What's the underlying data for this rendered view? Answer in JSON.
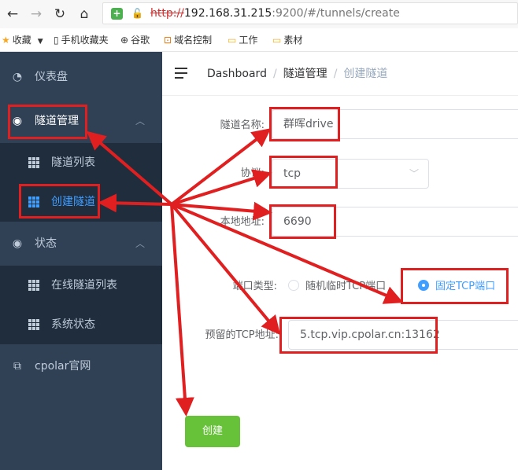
{
  "browser": {
    "url_protocol": "http://",
    "url_host": "192.168.31.215",
    "url_rest": ":9200/#/tunnels/create",
    "bookmarks": [
      {
        "icon": "★",
        "label": "收藏"
      },
      {
        "icon": "▯",
        "label": "手机收藏夹"
      },
      {
        "icon": "⊕",
        "label": "谷歌"
      },
      {
        "icon": "⊡",
        "label": "域名控制"
      },
      {
        "icon": "▭",
        "label": "工作"
      },
      {
        "icon": "▭",
        "label": "素材"
      }
    ]
  },
  "sidebar": {
    "dashboard": "仪表盘",
    "tunnel_mgmt": "隧道管理",
    "tunnel_list": "隧道列表",
    "create_tunnel": "创建隧道",
    "status": "状态",
    "online_tunnels": "在线隧道列表",
    "system_status": "系统状态",
    "cpolar_site": "cpolar官网"
  },
  "breadcrumb": {
    "home": "Dashboard",
    "section": "隧道管理",
    "current": "创建隧道"
  },
  "form": {
    "name_label": "隧道名称:",
    "name_value": "群晖drive",
    "protocol_label": "协议:",
    "protocol_value": "tcp",
    "local_addr_label": "本地地址:",
    "local_addr_value": "6690",
    "port_type_label": "端口类型:",
    "port_random": "随机临时TCP端口",
    "port_fixed": "固定TCP端口",
    "reserved_label": "预留的TCP地址:",
    "reserved_value": "5.tcp.vip.cpolar.cn:13162",
    "create_button": "创建"
  },
  "colors": {
    "sidebar_bg": "#304156",
    "submenu_bg": "#1f2d3d",
    "active": "#409eff",
    "create_button": "#67c23a",
    "annotation_red": "#e02020"
  }
}
